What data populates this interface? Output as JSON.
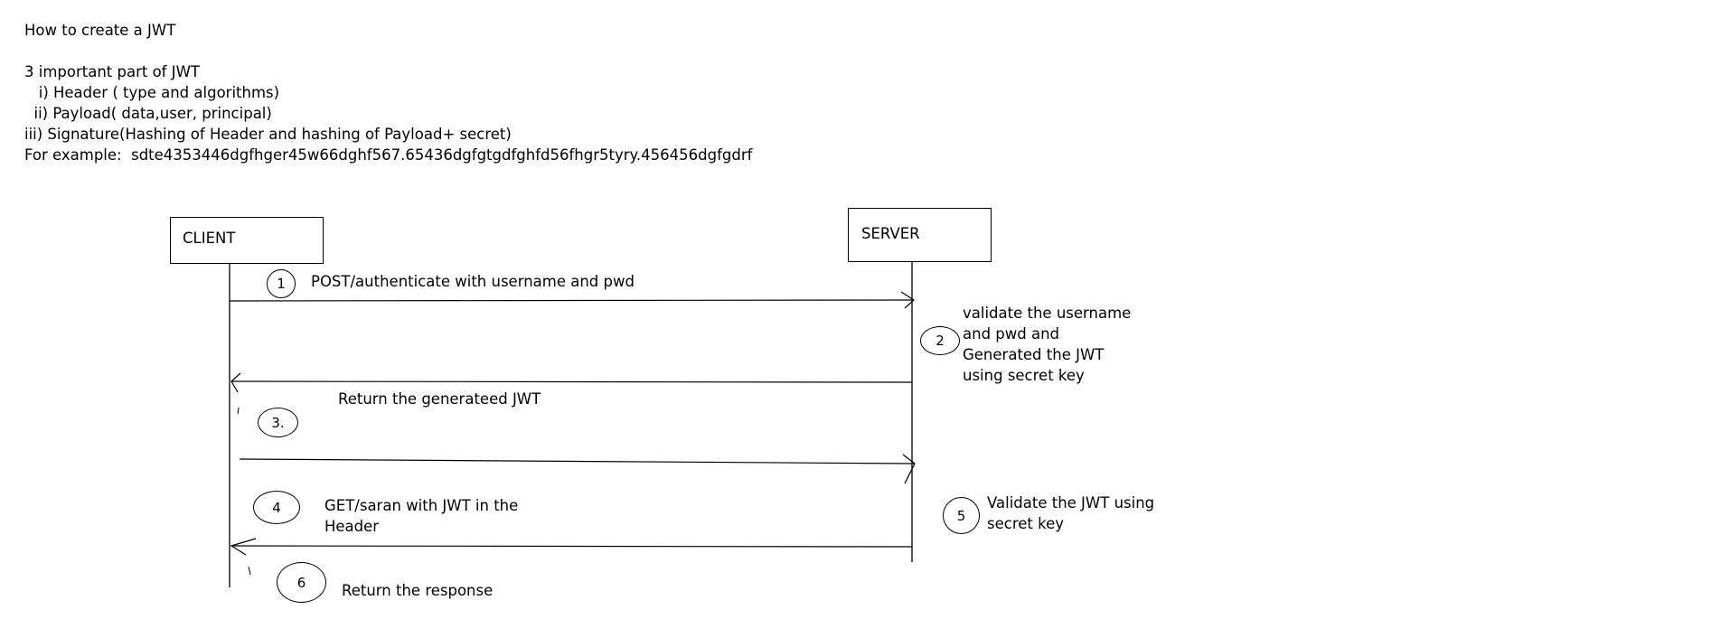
{
  "notes": {
    "title": "How to create a JWT",
    "parts_heading": "3 important part of JWT",
    "part1": "   i) Header ( type and algorithms)",
    "part2": "  ii) Payload( data,user, principal)",
    "part3": "iii) Signature(Hashing of Header and hashing of Payload+ secret)",
    "example": "For example:  sdte4353446dgfhger45w66dghf567.65436dgfgtgdfghfd56fhgr5tyry.456456dgfgdrf"
  },
  "diagram": {
    "client_label": "CLIENT",
    "server_label": "SERVER",
    "steps": [
      {
        "num": "1",
        "text": "POST/authenticate with username and pwd"
      },
      {
        "num": "2",
        "text_lines": [
          "validate the username",
          "and pwd and",
          "Generated the JWT",
          "using secret key"
        ]
      },
      {
        "num": "3.",
        "text": "Return the generateed JWT"
      },
      {
        "num": "4",
        "text_lines": [
          "GET/saran with JWT in the",
          "Header"
        ]
      },
      {
        "num": "5",
        "text_lines": [
          "Validate the JWT using",
          "secret key"
        ]
      },
      {
        "num": "6",
        "text": "Return the response"
      }
    ]
  }
}
